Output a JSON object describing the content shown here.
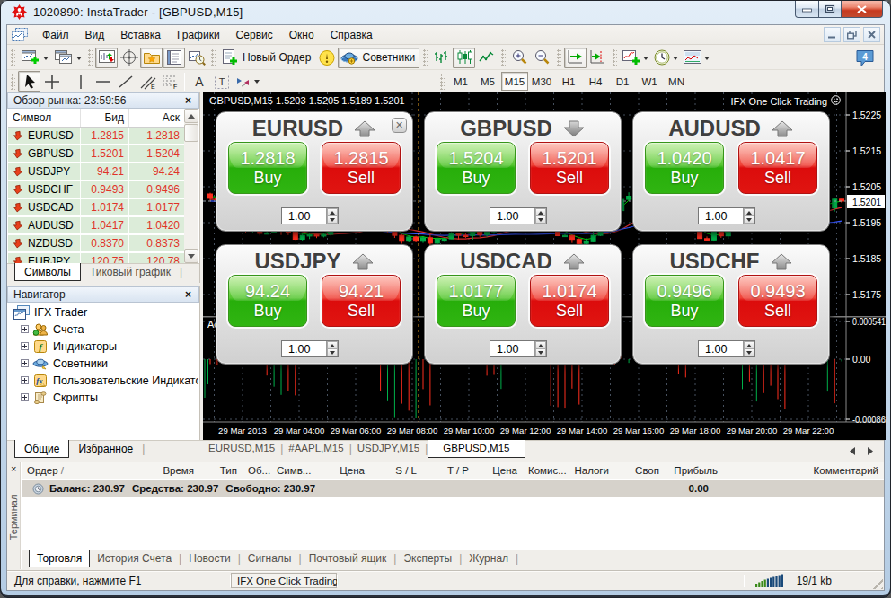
{
  "window": {
    "title": "1020890: InstaTrader - [GBPUSD,M15]",
    "logo_icon": "instatrader-logo",
    "buttons": {
      "minimize": "minimize",
      "restore": "restore",
      "close": "close"
    }
  },
  "menu": {
    "items": [
      {
        "label": "Файл",
        "u": 0
      },
      {
        "label": "Вид",
        "u": 0
      },
      {
        "label": "Вставка",
        "u": 3
      },
      {
        "label": "Графики",
        "u": 0
      },
      {
        "label": "Сервис",
        "u": 1
      },
      {
        "label": "Окно",
        "u": 0
      },
      {
        "label": "Справка",
        "u": 0
      }
    ]
  },
  "toolbar1": {
    "groups": [
      {
        "buttons": [
          {
            "icon": "new-chart",
            "caret": true
          },
          {
            "icon": "profiles",
            "caret": true
          }
        ]
      },
      {
        "buttons": [
          {
            "icon": "market-watch",
            "pressed": true
          },
          {
            "icon": "data-window"
          },
          {
            "icon": "navigator",
            "pressed": true
          },
          {
            "icon": "terminal",
            "pressed": true
          },
          {
            "icon": "strategy-tester"
          }
        ]
      },
      {
        "buttons": [
          {
            "icon": "new-order",
            "label": "Новый Ордер"
          },
          {
            "icon": "warning"
          },
          {
            "icon": "experts",
            "label": "Советники",
            "pressed": true
          }
        ]
      },
      {
        "buttons": [
          {
            "icon": "chart-bars"
          },
          {
            "icon": "chart-candles",
            "pressed": true
          },
          {
            "icon": "chart-line"
          }
        ]
      },
      {
        "buttons": [
          {
            "icon": "zoom-in"
          },
          {
            "icon": "zoom-out"
          }
        ]
      },
      {
        "buttons": [
          {
            "icon": "auto-scroll",
            "pressed": true
          },
          {
            "icon": "chart-shift"
          }
        ]
      },
      {
        "buttons": [
          {
            "icon": "indicators",
            "caret": true
          },
          {
            "icon": "periods",
            "caret": true
          },
          {
            "icon": "templates",
            "caret": true
          }
        ]
      }
    ],
    "right_icon": "comment-4"
  },
  "toolbar2": {
    "groups": [
      {
        "buttons": [
          {
            "icon": "cursor",
            "pressed": true
          },
          {
            "icon": "crosshair"
          }
        ]
      },
      {
        "buttons": [
          {
            "icon": "vline"
          },
          {
            "icon": "hline"
          },
          {
            "icon": "trendline"
          },
          {
            "icon": "channel"
          },
          {
            "icon": "fibo"
          }
        ]
      },
      {
        "buttons": [
          {
            "icon": "text-a"
          },
          {
            "icon": "text-label"
          },
          {
            "icon": "shapes",
            "caret": true
          }
        ]
      }
    ],
    "timeframes": [
      {
        "label": "M1"
      },
      {
        "label": "M5"
      },
      {
        "label": "M15",
        "active": true
      },
      {
        "label": "M30"
      },
      {
        "label": "H1"
      },
      {
        "label": "H4"
      },
      {
        "label": "D1"
      },
      {
        "label": "W1"
      },
      {
        "label": "MN"
      }
    ]
  },
  "market_watch": {
    "title": "Обзор рынка: 23:59:56",
    "close_label": "×",
    "columns": [
      "Символ",
      "Бид",
      "Аск"
    ],
    "rows": [
      {
        "symbol": "EURUSD",
        "bid": "1.2815",
        "ask": "1.2818"
      },
      {
        "symbol": "GBPUSD",
        "bid": "1.5201",
        "ask": "1.5204"
      },
      {
        "symbol": "USDJPY",
        "bid": "94.21",
        "ask": "94.24"
      },
      {
        "symbol": "USDCHF",
        "bid": "0.9493",
        "ask": "0.9496"
      },
      {
        "symbol": "USDCAD",
        "bid": "1.0174",
        "ask": "1.0177"
      },
      {
        "symbol": "AUDUSD",
        "bid": "1.0417",
        "ask": "1.0420"
      },
      {
        "symbol": "NZDUSD",
        "bid": "0.8370",
        "ask": "0.8373"
      },
      {
        "symbol": "EURJPY",
        "bid": "120.75",
        "ask": "120.78"
      }
    ],
    "tabs": [
      {
        "label": "Символы",
        "active": true
      },
      {
        "label": "Тиковый график"
      }
    ]
  },
  "navigator": {
    "title": "Навигатор",
    "close_label": "×",
    "root": {
      "label": "IFX Trader",
      "icon": "ifx-root"
    },
    "items": [
      {
        "label": "Счета",
        "icon": "accounts"
      },
      {
        "label": "Индикаторы",
        "icon": "indicator-f"
      },
      {
        "label": "Советники",
        "icon": "advisor"
      },
      {
        "label": "Пользовательские Индикато",
        "icon": "custom-indicator"
      },
      {
        "label": "Скрипты",
        "icon": "scripts"
      }
    ],
    "tabs": [
      {
        "label": "Общие",
        "active": true
      },
      {
        "label": "Избранное"
      }
    ]
  },
  "chart": {
    "quote_line": "GBPUSD,M15  1.5203 1.5205 1.5189 1.5201",
    "overlay_title": "IFX One Click Trading",
    "overlay_smiley": "smiley-icon",
    "price_labels": [
      "1.5225",
      "1.5215",
      "1.5205",
      "1.5195",
      "1.5185",
      "1.5175"
    ],
    "current_price": "1.5201",
    "sub_labels": [
      "0.000541",
      "0.00",
      "-0.00086"
    ],
    "sub_indicator_fragment": "Ac",
    "time_labels": [
      "29 Mar 2013",
      "29 Mar 04:00",
      "29 Mar 06:00",
      "29 Mar 08:00",
      "29 Mar 10:00",
      "29 Mar 12:00",
      "29 Mar 14:00",
      "29 Mar 16:00",
      "29 Mar 18:00",
      "29 Mar 20:00",
      "29 Mar 22:00"
    ],
    "colors": {
      "up": "#00b14a",
      "down": "#ff2e1e",
      "grid": "#46505e",
      "bg": "#000000"
    }
  },
  "trade_panels": [
    {
      "pair": "EURUSD",
      "direction": "up",
      "buy_price": "1.2818",
      "sell_price": "1.2815",
      "buy_label": "Buy",
      "sell_label": "Sell",
      "volume": "1.00",
      "closable": true
    },
    {
      "pair": "GBPUSD",
      "direction": "down",
      "buy_price": "1.5204",
      "sell_price": "1.5201",
      "buy_label": "Buy",
      "sell_label": "Sell",
      "volume": "1.00"
    },
    {
      "pair": "AUDUSD",
      "direction": "up",
      "buy_price": "1.0420",
      "sell_price": "1.0417",
      "buy_label": "Buy",
      "sell_label": "Sell",
      "volume": "1.00"
    },
    {
      "pair": "USDJPY",
      "direction": "up",
      "buy_price": "94.24",
      "sell_price": "94.21",
      "buy_label": "Buy",
      "sell_label": "Sell",
      "volume": "1.00"
    },
    {
      "pair": "USDCAD",
      "direction": "up",
      "buy_price": "1.0177",
      "sell_price": "1.0174",
      "buy_label": "Buy",
      "sell_label": "Sell",
      "volume": "1.00"
    },
    {
      "pair": "USDCHF",
      "direction": "up",
      "buy_price": "0.9496",
      "sell_price": "0.9493",
      "buy_label": "Buy",
      "sell_label": "Sell",
      "volume": "1.00"
    }
  ],
  "chart_tabs": {
    "tabs": [
      {
        "label": "EURUSD,M15"
      },
      {
        "label": "#AAPL,M15"
      },
      {
        "label": "USDJPY,M15"
      },
      {
        "label": "GBPUSD,M15",
        "active": true
      }
    ]
  },
  "terminal": {
    "side_label": "Терминал",
    "close_label": "×",
    "columns": [
      "Ордер",
      "Время",
      "Тип",
      "Об...",
      "Симв...",
      "Цена",
      "S / L",
      "T / P",
      "Цена",
      "Комис...",
      "Налоги",
      "Своп",
      "Прибыль",
      "Комментарий"
    ],
    "balance_row": {
      "icon": "balance-icon",
      "balance": "Баланс: 230.97",
      "equity": "Средства: 230.97",
      "free": "Свободно: 230.97",
      "profit": "0.00"
    },
    "tabs": [
      {
        "label": "Торговля",
        "active": true
      },
      {
        "label": "История Счета"
      },
      {
        "label": "Новости"
      },
      {
        "label": "Сигналы"
      },
      {
        "label": "Почтовый ящик"
      },
      {
        "label": "Эксперты"
      },
      {
        "label": "Журнал"
      }
    ]
  },
  "status_bar": {
    "help_text": "Для справки, нажмите F1",
    "mode_text": "IFX One Click Trading",
    "connection_icon": "signal-bars",
    "traffic": "19/1 kb"
  }
}
